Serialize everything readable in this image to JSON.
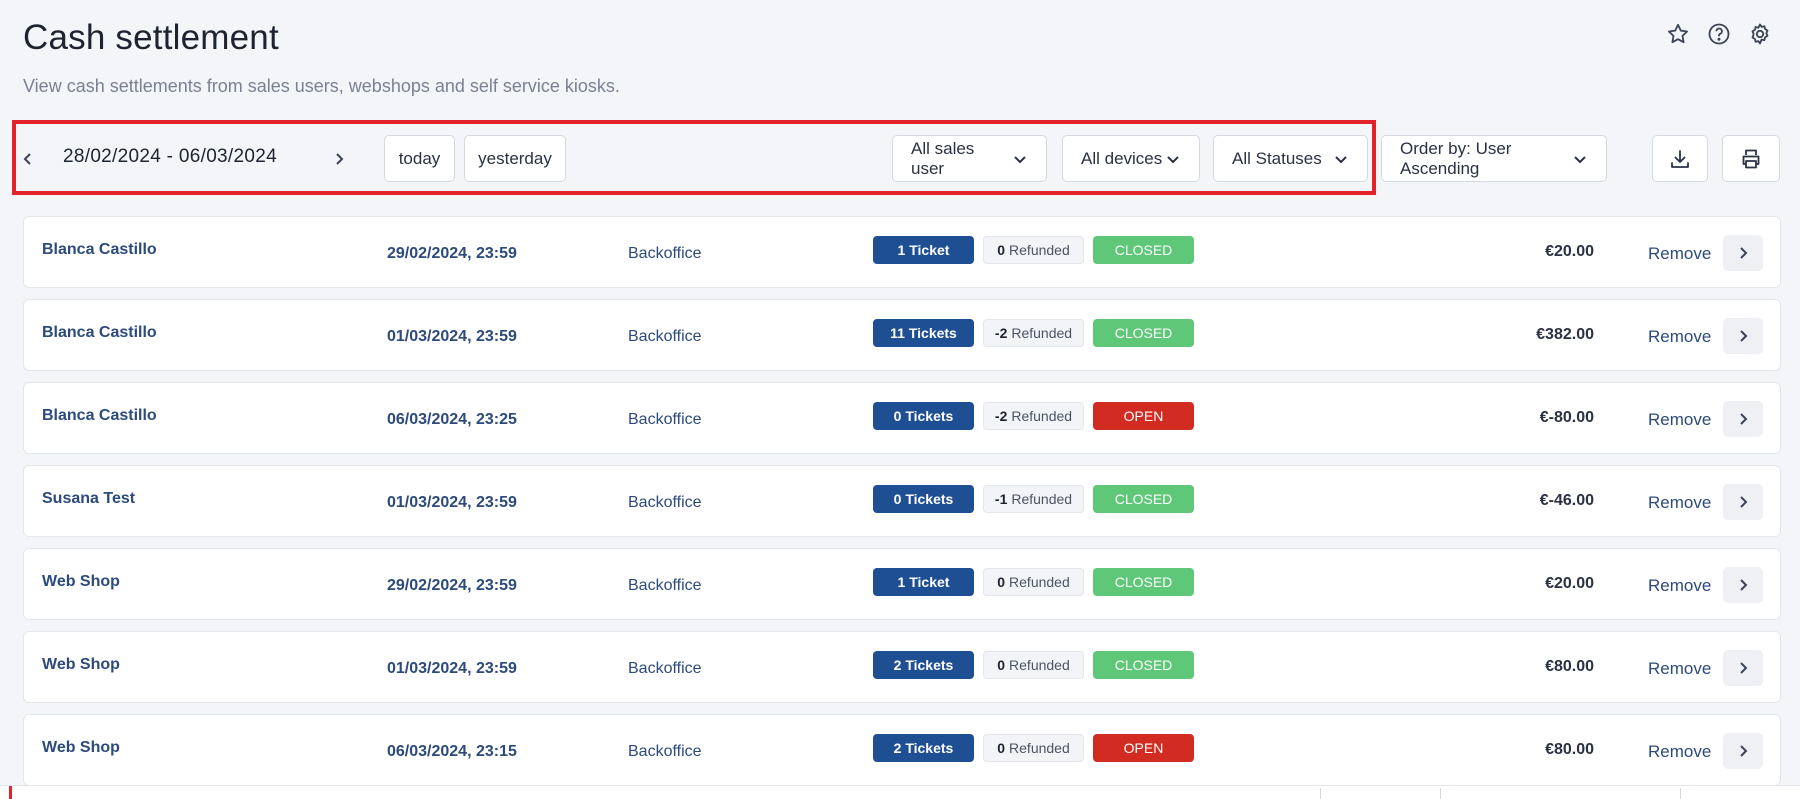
{
  "header": {
    "title": "Cash settlement",
    "subtitle": "View cash settlements from sales users, webshops and self service kiosks."
  },
  "top_icons": [
    "star-icon",
    "help-icon",
    "gear-icon"
  ],
  "toolbar": {
    "date_range": "28/02/2024 - 06/03/2024",
    "today_label": "today",
    "yesterday_label": "yesterday",
    "sales_user_select": "All sales user",
    "devices_select": "All devices",
    "status_select": "All Statuses",
    "order_select": "Order by: User Ascending"
  },
  "rows": [
    {
      "user": "Blanca Castillo",
      "date": "29/02/2024, 23:59",
      "device": "Backoffice",
      "tickets": "1 Ticket",
      "refunded_count": "0",
      "refunded_label": "Refunded",
      "status": "CLOSED",
      "amount": "€20.00",
      "remove": "Remove"
    },
    {
      "user": "Blanca Castillo",
      "date": "01/03/2024, 23:59",
      "device": "Backoffice",
      "tickets": "11 Tickets",
      "refunded_count": "-2",
      "refunded_label": "Refunded",
      "status": "CLOSED",
      "amount": "€382.00",
      "remove": "Remove"
    },
    {
      "user": "Blanca Castillo",
      "date": "06/03/2024, 23:25",
      "device": "Backoffice",
      "tickets": "0 Tickets",
      "refunded_count": "-2",
      "refunded_label": "Refunded",
      "status": "OPEN",
      "amount": "€-80.00",
      "remove": "Remove"
    },
    {
      "user": "Susana Test",
      "date": "01/03/2024, 23:59",
      "device": "Backoffice",
      "tickets": "0 Tickets",
      "refunded_count": "-1",
      "refunded_label": "Refunded",
      "status": "CLOSED",
      "amount": "€-46.00",
      "remove": "Remove"
    },
    {
      "user": "Web Shop",
      "date": "29/02/2024, 23:59",
      "device": "Backoffice",
      "tickets": "1 Ticket",
      "refunded_count": "0",
      "refunded_label": "Refunded",
      "status": "CLOSED",
      "amount": "€20.00",
      "remove": "Remove"
    },
    {
      "user": "Web Shop",
      "date": "01/03/2024, 23:59",
      "device": "Backoffice",
      "tickets": "2 Tickets",
      "refunded_count": "0",
      "refunded_label": "Refunded",
      "status": "CLOSED",
      "amount": "€80.00",
      "remove": "Remove"
    },
    {
      "user": "Web Shop",
      "date": "06/03/2024, 23:15",
      "device": "Backoffice",
      "tickets": "2 Tickets",
      "refunded_count": "0",
      "refunded_label": "Refunded",
      "status": "OPEN",
      "amount": "€80.00",
      "remove": "Remove"
    }
  ],
  "colors": {
    "highlight": "#e2232a",
    "ticket_badge": "#1f4f93",
    "closed": "#5ec878",
    "open": "#d22b21",
    "link": "#2c4a7c"
  }
}
